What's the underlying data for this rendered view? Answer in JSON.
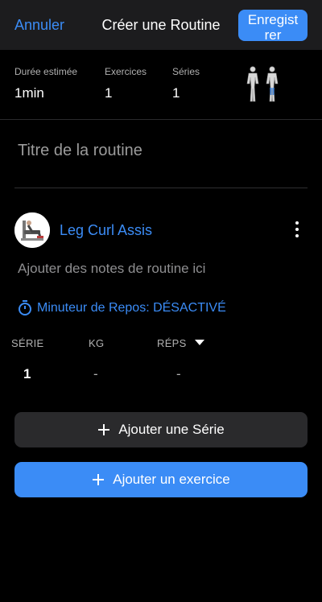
{
  "header": {
    "cancel_label": "Annuler",
    "title": "Créer une Routine",
    "save_label": "Enregistrer"
  },
  "stats": [
    {
      "label": "Durée estimée",
      "value": "1min"
    },
    {
      "label": "Exercices",
      "value": "1"
    },
    {
      "label": "Séries",
      "value": "1"
    }
  ],
  "routine": {
    "title_placeholder": "Titre de la routine"
  },
  "exercise": {
    "name": "Leg Curl Assis",
    "notes_placeholder": "Ajouter des notes de routine ici",
    "rest_timer": "Minuteur de Repos: DÉSACTIVÉ",
    "columns": [
      "SÉRIE",
      "KG",
      "RÉPS"
    ],
    "rows": [
      {
        "set": "1",
        "kg": "-",
        "reps": "-"
      }
    ]
  },
  "actions": {
    "add_set": "Ajouter une Série",
    "add_exercise": "Ajouter un exercice"
  },
  "colors": {
    "accent": "#3b8cf6",
    "background": "#000000",
    "header_bg": "#1c1c1e",
    "secondary_button": "#2a2a2c"
  }
}
